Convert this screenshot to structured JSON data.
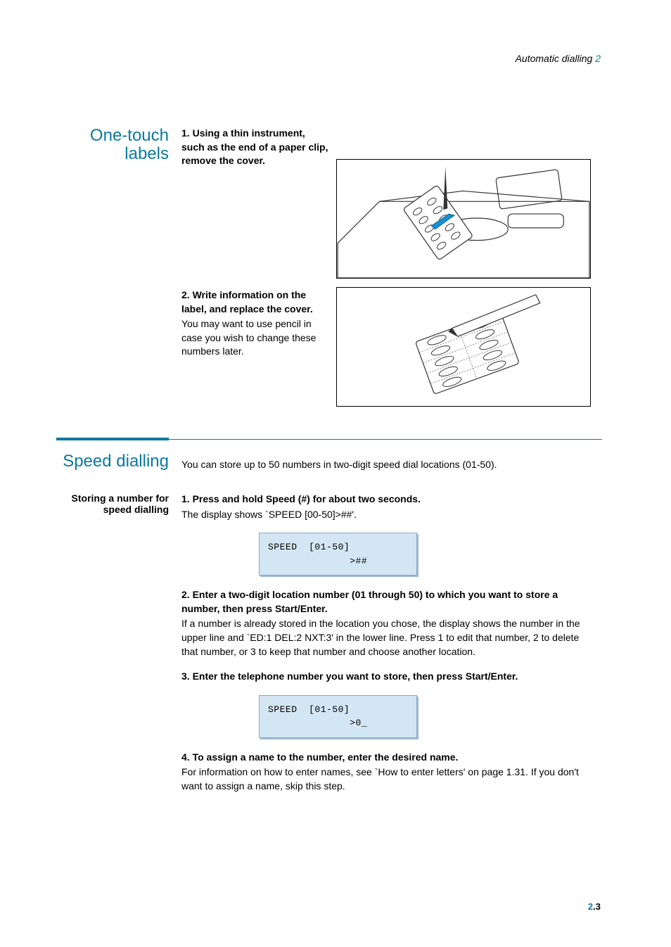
{
  "header": {
    "italic": "Automatic dialling",
    "teal_suffix": "2"
  },
  "label_section": {
    "line1": "One-touch",
    "line2": "labels"
  },
  "steps_a": [
    {
      "num": "1.",
      "bold": "Using a thin instrument, such as the end of a paper clip, remove the cover.",
      "body": ""
    },
    {
      "num": "2.",
      "bold": "Write information on the label, and replace the cover.",
      "body": "You may want to use pencil in case you wish to change these numbers later."
    }
  ],
  "section2": {
    "title": "Speed dialling",
    "intro": "You can store up to 50 numbers in two-digit speed dial locations (01-50).",
    "sub": "Storing a number for speed dialling",
    "steps": [
      {
        "num": "1.",
        "bold": "Press and hold Speed (#) for about two seconds.",
        "body": "The display shows `SPEED [00-50]>##'."
      },
      {
        "lcd": "SPEED  [01-50]\n              >##"
      },
      {
        "num": "2.",
        "bold": "Enter a two-digit location number (01 through 50) to which you want to store a number, then press Start/Enter.",
        "body": "If a number is already stored in the location you chose, the display shows the number in the upper line and `ED:1 DEL:2 NXT:3' in the lower line. Press 1 to edit that number, 2 to delete that number, or 3 to keep that number and choose another location."
      },
      {
        "num": "3.",
        "bold": "Enter the telephone number you want to store, then press Start/Enter.",
        "body": ""
      },
      {
        "lcd": "SPEED  [01-50]\n              >0_"
      },
      {
        "num": "4.",
        "bold": "To assign a name to the number, enter the desired name.",
        "body": "For information on how to enter names, see `How to enter letters' on page 1.31. If you don't want to assign a name, skip this step."
      }
    ]
  },
  "page_number": {
    "num": "2",
    "dot": ".3"
  }
}
